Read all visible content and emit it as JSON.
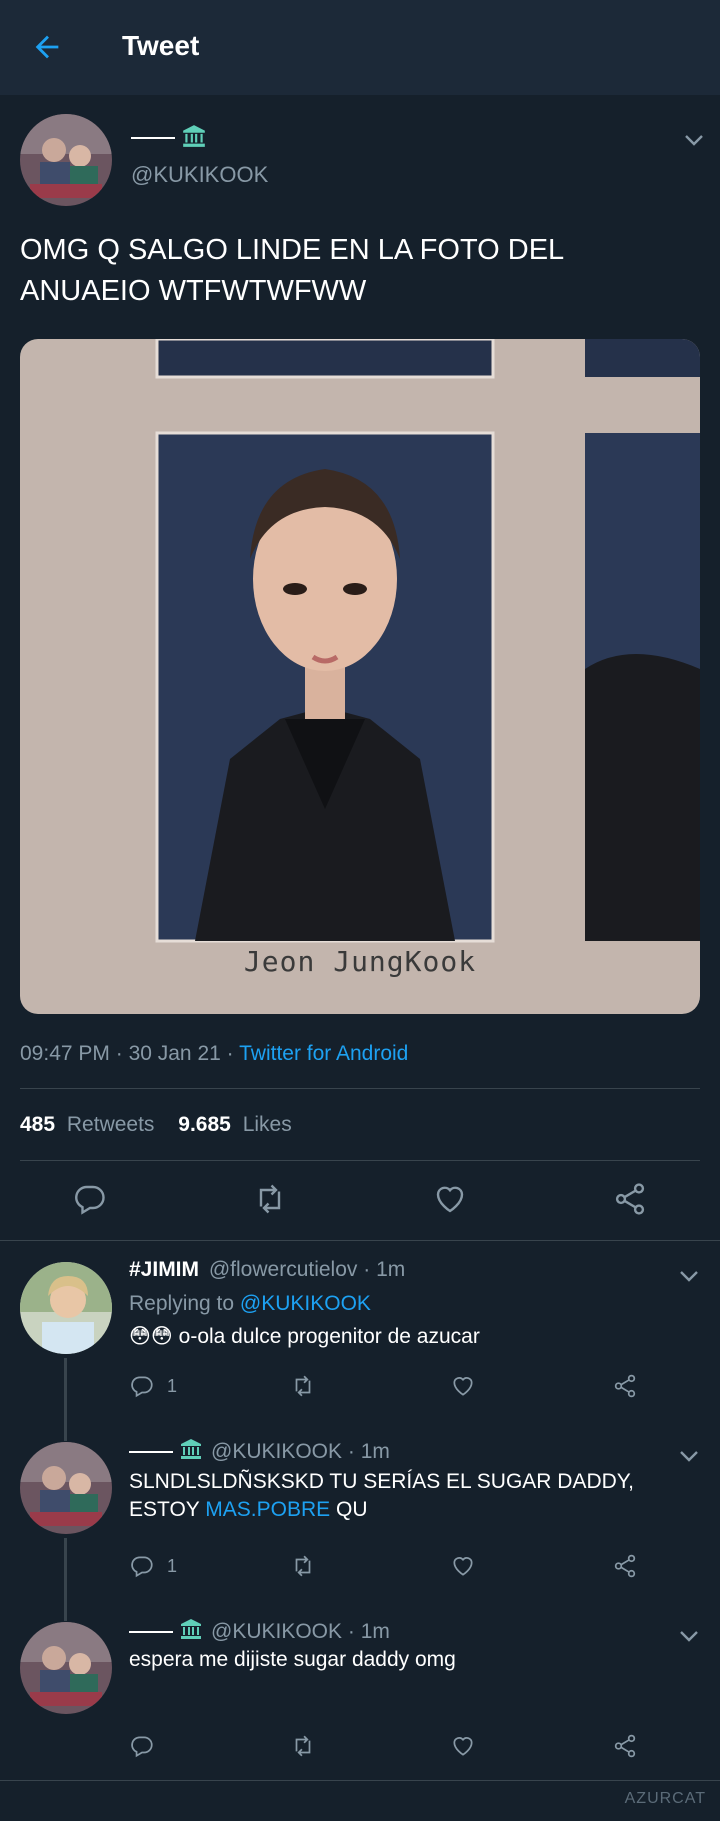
{
  "header": {
    "title": "Tweet"
  },
  "tweet": {
    "handle": "@KUKIKOOK",
    "text": "OMG Q SALGO LINDE EN LA FOTO DEL ANUAEIO WTFWTWFWW",
    "image_caption": "Jeon JungKook",
    "time": "09:47 PM",
    "date": "30 Jan 21",
    "source": "Twitter for Android",
    "retweets_count": "485",
    "retweets_label": "Retweets",
    "likes_count": "9.685",
    "likes_label": "Likes"
  },
  "replies": [
    {
      "name": "#JIMIM",
      "handle": "@flowercutielov",
      "time": "1m",
      "replying_label": "Replying to",
      "replying_to": "@KUKIKOOK",
      "emojis": "😳😳",
      "text": "o-ola dulce progenitor de azucar",
      "reply_count": "1"
    },
    {
      "handle": "@KUKIKOOK",
      "time": "1m",
      "text": "SLNDLSLDÑSKSKD TU SERÍAS EL SUGAR DADDY, ESTOY",
      "text_link": "MAS.POBRE",
      "text_tail": "QU",
      "reply_count": "1"
    },
    {
      "handle": "@KUKIKOOK",
      "time": "1m",
      "text": "espera me dijiste sugar daddy omg"
    }
  ],
  "watermark": "AZURCAT",
  "colors": {
    "background": "#15202b",
    "header": "#1c2938",
    "accent": "#1da1f2",
    "muted": "#8899a6",
    "divider": "#38444d",
    "bank_icon": "#5fcfb8"
  }
}
